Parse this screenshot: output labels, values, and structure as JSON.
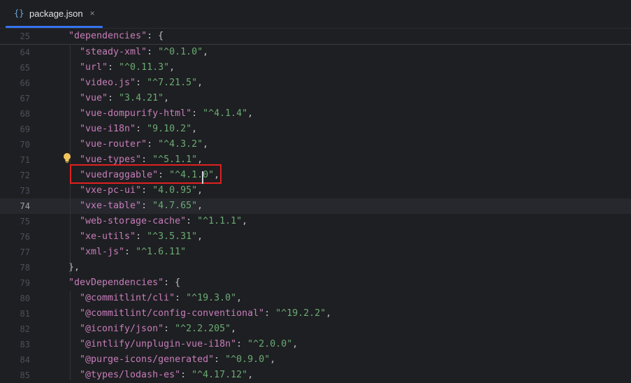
{
  "tab": {
    "icon": "{}",
    "label": "package.json",
    "close": "×"
  },
  "sticky": {
    "line_number": "25",
    "key": "\"dependencies\"",
    "rest": ": {"
  },
  "lines": [
    {
      "n": "64",
      "key": "\"steady-xml\"",
      "val": "\"^0.1.0\"",
      "end": ","
    },
    {
      "n": "65",
      "key": "\"url\"",
      "val": "\"^0.11.3\"",
      "end": ","
    },
    {
      "n": "66",
      "key": "\"video.js\"",
      "val": "\"^7.21.5\"",
      "end": ","
    },
    {
      "n": "67",
      "key": "\"vue\"",
      "val": "\"3.4.21\"",
      "end": ","
    },
    {
      "n": "68",
      "key": "\"vue-dompurify-html\"",
      "val": "\"^4.1.4\"",
      "end": ","
    },
    {
      "n": "69",
      "key": "\"vue-i18n\"",
      "val": "\"9.10.2\"",
      "end": ","
    },
    {
      "n": "70",
      "key": "\"vue-router\"",
      "val": "\"^4.3.2\"",
      "end": ","
    },
    {
      "n": "71",
      "key": "\"vue-types\"",
      "val": "\"^5.1.1\"",
      "end": ","
    },
    {
      "n": "72",
      "key": "\"vuedraggable\"",
      "val": "\"^4.1.0\"",
      "end": ","
    },
    {
      "n": "73",
      "key": "\"vxe-pc-ui\"",
      "val": "\"4.0.95\"",
      "end": ","
    },
    {
      "n": "74",
      "key": "\"vxe-table\"",
      "val": "\"4.7.65\"",
      "end": ","
    },
    {
      "n": "75",
      "key": "\"web-storage-cache\"",
      "val": "\"^1.1.1\"",
      "end": ","
    },
    {
      "n": "76",
      "key": "\"xe-utils\"",
      "val": "\"^3.5.31\"",
      "end": ","
    },
    {
      "n": "77",
      "key": "\"xml-js\"",
      "val": "\"^1.6.11\"",
      "end": ""
    },
    {
      "n": "78",
      "plain": "},"
    },
    {
      "n": "79",
      "key": "\"devDependencies\"",
      "rest": ": {"
    },
    {
      "n": "80",
      "key": "\"@commitlint/cli\"",
      "val": "\"^19.3.0\"",
      "end": ","
    },
    {
      "n": "81",
      "key": "\"@commitlint/config-conventional\"",
      "val": "\"^19.2.2\"",
      "end": ","
    },
    {
      "n": "82",
      "key": "\"@iconify/json\"",
      "val": "\"^2.2.205\"",
      "end": ","
    },
    {
      "n": "83",
      "key": "\"@intlify/unplugin-vue-i18n\"",
      "val": "\"^2.0.0\"",
      "end": ","
    },
    {
      "n": "84",
      "key": "\"@purge-icons/generated\"",
      "val": "\"^0.9.0\"",
      "end": ","
    },
    {
      "n": "85",
      "key": "\"@types/lodash-es\"",
      "val": "\"^4.17.12\"",
      "end": ","
    }
  ],
  "current_line": "74",
  "colors": {
    "key": "#c77dbb",
    "string": "#6aab73",
    "highlight_box": "#e02020",
    "tab_underline": "#3574f0"
  },
  "icons": [
    "json-file-icon",
    "close-icon",
    "lightbulb-icon"
  ]
}
